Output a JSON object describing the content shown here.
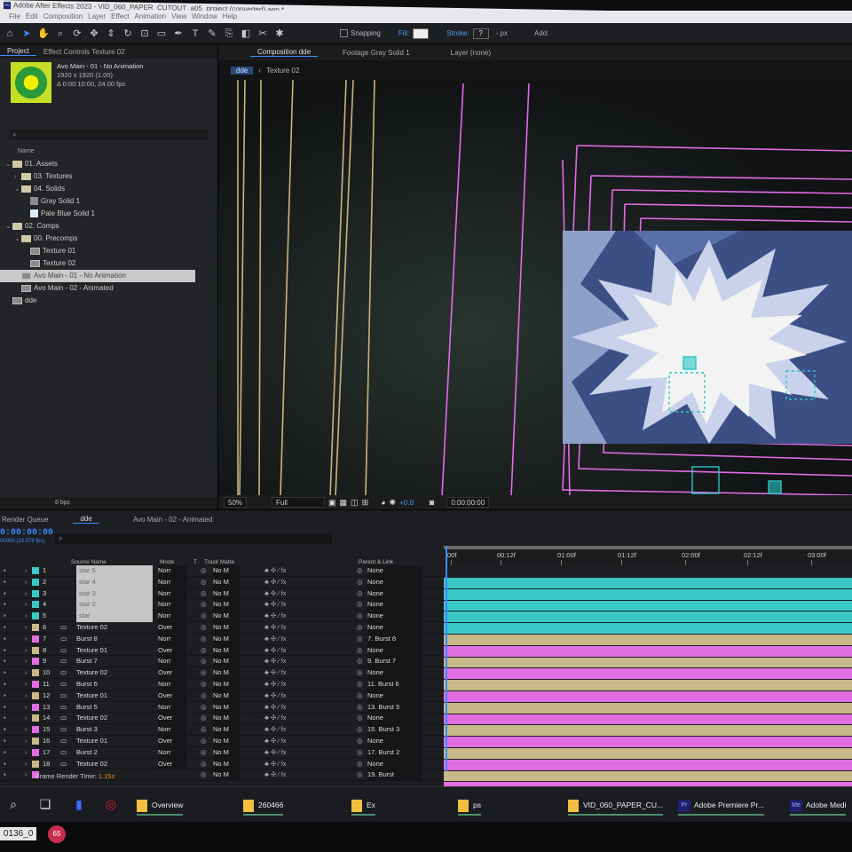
{
  "window": {
    "title": "Adobe After Effects 2023 - VID_060_PAPER_CUTOUT_a05_project (converted).aep *",
    "menu": [
      "File",
      "Edit",
      "Composition",
      "Layer",
      "Effect",
      "Animation",
      "View",
      "Window",
      "Help"
    ]
  },
  "toolbar": {
    "tools": [
      "home-icon",
      "selection-icon",
      "hand-icon",
      "zoom-icon",
      "orbit-icon",
      "pan-icon",
      "dolly-icon",
      "rotate-icon",
      "camera-icon",
      "shape-icon",
      "pen-icon",
      "type-icon",
      "brush-icon",
      "clone-icon",
      "eraser-icon",
      "roto-icon",
      "puppet-icon"
    ],
    "snapping_label": "Snapping",
    "fill_label": "Fill:",
    "stroke_label": "Stroke:",
    "stroke_value": "?",
    "px_label": "- px",
    "add_label": "Add:"
  },
  "project": {
    "tabs": [
      "Project",
      "Effect Controls Texture 02"
    ],
    "thumb_title": "Avo Main - 01 - No Animation",
    "thumb_size": "1920 x 1920 (1.00)",
    "thumb_duration": "Δ 0:00:10:00, 24.00 fps",
    "search_placeholder": "⌕",
    "name_header": "Name",
    "tree": [
      {
        "indent": 0,
        "arrow": "⌄",
        "type": "folder",
        "label": "01. Assets"
      },
      {
        "indent": 1,
        "arrow": "›",
        "type": "folder",
        "label": "03. Textures"
      },
      {
        "indent": 1,
        "arrow": "⌄",
        "type": "folder",
        "label": "04. Solids"
      },
      {
        "indent": 2,
        "arrow": "",
        "type": "solid",
        "color": "#8a8a8a",
        "label": "Gray Solid 1"
      },
      {
        "indent": 2,
        "arrow": "",
        "type": "solid",
        "color": "#dfe8f5",
        "label": "Pale Blue Solid 1"
      },
      {
        "indent": 0,
        "arrow": "⌄",
        "type": "folder",
        "label": "02. Comps"
      },
      {
        "indent": 1,
        "arrow": "⌄",
        "type": "folder",
        "label": "00. Precomps"
      },
      {
        "indent": 2,
        "arrow": "",
        "type": "comp",
        "label": "Texture 01"
      },
      {
        "indent": 2,
        "arrow": "",
        "type": "comp",
        "label": "Texture 02"
      },
      {
        "indent": 1,
        "arrow": "",
        "type": "comp",
        "label": "Avo Main - 01 - No Animation",
        "selected": true
      },
      {
        "indent": 1,
        "arrow": "",
        "type": "comp",
        "label": "Avo Main - 02 - Animated"
      },
      {
        "indent": 0,
        "arrow": "",
        "type": "comp",
        "label": "dde"
      }
    ],
    "bpc": "8 bpc"
  },
  "viewer": {
    "tabs": [
      "Composition dde",
      "Footage Gray Solid 1",
      "Layer (none)"
    ],
    "breadcrumb_active": "dde",
    "breadcrumb_next": "Texture 02",
    "zoom": "50%",
    "resolution": "Full",
    "exposure": "+0.0",
    "timecode": "0:00:00:00"
  },
  "timeline": {
    "tabs": [
      "Render Queue",
      "dde",
      "Avo Main - 02 - Animated"
    ],
    "timecode": "0:00:00:00",
    "fps": "00000 (23.976 fps)",
    "columns": {
      "source": "Source Name",
      "mode": "Mode",
      "t": "T",
      "track": "Track Matte",
      "parent": "Parent & Link"
    },
    "ruler": [
      "00f",
      "00:12f",
      "01:00f",
      "01:12f",
      "02:00f",
      "02:12f",
      "03:00f"
    ],
    "layers": [
      {
        "num": "1",
        "color": "#3cc7c7",
        "name": "star 5",
        "light": true,
        "mode": "Norr",
        "parent": "None"
      },
      {
        "num": "2",
        "color": "#3cc7c7",
        "name": "star 4",
        "light": true,
        "mode": "Norr",
        "parent": "None"
      },
      {
        "num": "3",
        "color": "#3cc7c7",
        "name": "star 3",
        "light": true,
        "mode": "Norr",
        "parent": "None"
      },
      {
        "num": "4",
        "color": "#3cc7c7",
        "name": "star 2",
        "light": true,
        "mode": "Norr",
        "parent": "None"
      },
      {
        "num": "5",
        "color": "#3cc7c7",
        "name": "star",
        "light": true,
        "mode": "Norr",
        "parent": "None"
      },
      {
        "num": "6",
        "color": "#c9b88a",
        "name": "Texture 02",
        "mode": "Over",
        "parent": "None"
      },
      {
        "num": "7",
        "color": "#e16ee1",
        "name": "Burst 8",
        "mode": "Norr",
        "parent": "7. Burst 8"
      },
      {
        "num": "8",
        "color": "#c9b88a",
        "name": "Texture 01",
        "mode": "Over",
        "parent": "None"
      },
      {
        "num": "9",
        "color": "#e16ee1",
        "name": "Burst 7",
        "mode": "Norr",
        "parent": "9. Burst 7"
      },
      {
        "num": "10",
        "color": "#c9b88a",
        "name": "Texture 02",
        "mode": "Over",
        "parent": "None"
      },
      {
        "num": "11",
        "color": "#e16ee1",
        "name": "Burst 6",
        "mode": "Norr",
        "parent": "11. Burst 6"
      },
      {
        "num": "12",
        "color": "#c9b88a",
        "name": "Texture 01",
        "mode": "Over",
        "parent": "None"
      },
      {
        "num": "13",
        "color": "#e16ee1",
        "name": "Burst 5",
        "mode": "Norr",
        "parent": "13. Burst 5"
      },
      {
        "num": "14",
        "color": "#c9b88a",
        "name": "Texture 02",
        "mode": "Over",
        "parent": "None"
      },
      {
        "num": "15",
        "color": "#e16ee1",
        "name": "Burst 3",
        "mode": "Norr",
        "parent": "15. Burst 3"
      },
      {
        "num": "16",
        "color": "#c9b88a",
        "name": "Texture 01",
        "mode": "Over",
        "parent": "None"
      },
      {
        "num": "17",
        "color": "#e16ee1",
        "name": "Burst 2",
        "mode": "Norr",
        "parent": "17. Burst 2"
      },
      {
        "num": "18",
        "color": "#c9b88a",
        "name": "Texture 02",
        "mode": "Over",
        "parent": "None"
      },
      {
        "num": "",
        "color": "#e16ee1",
        "name": "",
        "mode": "",
        "parent": "19. Burst"
      }
    ],
    "track_matte": "No M",
    "frame_render_label": "Frame Render Time:",
    "frame_render_value": "1.15s"
  },
  "taskbar": {
    "items": [
      {
        "type": "folder",
        "label": "Overview"
      },
      {
        "type": "folder",
        "label": "260466"
      },
      {
        "type": "folder",
        "label": "Ex"
      },
      {
        "type": "folder",
        "label": "ps"
      },
      {
        "type": "folder",
        "label": "VID_060_PAPER_CU..."
      },
      {
        "type": "app",
        "icon": "Pr",
        "label": "Adobe Premiere Pr..."
      },
      {
        "type": "app",
        "icon": "Me",
        "label": "Adobe Medi"
      }
    ],
    "bottom_label": "0136_0",
    "bottom_badge": "65"
  },
  "colors": {
    "accent": "#3d8bff",
    "cyan_layer": "#3cc7c7",
    "pink_layer": "#e16ee1",
    "tan_layer": "#c9b88a"
  }
}
